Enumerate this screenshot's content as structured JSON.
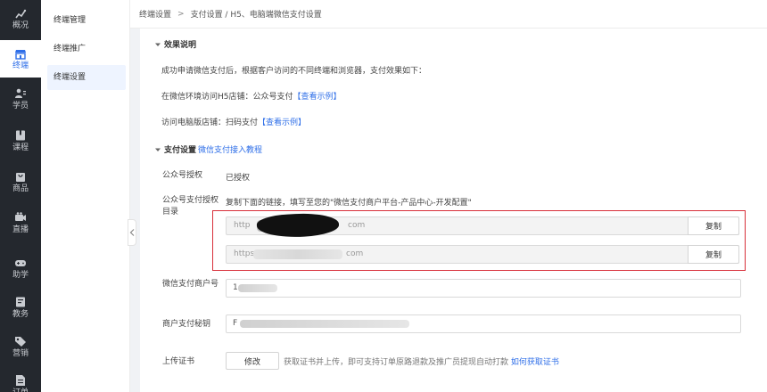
{
  "rail": {
    "items": [
      {
        "label": "概况",
        "icon": "chart-icon"
      },
      {
        "label": "终端",
        "icon": "store-icon"
      },
      {
        "label": "学员",
        "icon": "users-icon"
      },
      {
        "label": "课程",
        "icon": "book-icon"
      },
      {
        "label": "商品",
        "icon": "bag-icon"
      },
      {
        "label": "直播",
        "icon": "video-icon"
      },
      {
        "label": "助学",
        "icon": "gamepad-icon"
      },
      {
        "label": "教务",
        "icon": "notebook-icon"
      },
      {
        "label": "营销",
        "icon": "tag-icon"
      },
      {
        "label": "订单",
        "icon": "document-icon"
      }
    ],
    "active_index": 1,
    "active_color": "#2f6fe8",
    "background": "#24282e"
  },
  "subnav": {
    "items": [
      {
        "label": "终端管理"
      },
      {
        "label": "终端推广"
      },
      {
        "label": "终端设置"
      }
    ],
    "active_index": 2
  },
  "breadcrumb": {
    "root": "终端设置",
    "separator": ">",
    "current": "支付设置 / H5、电脑端微信支付设置"
  },
  "effect": {
    "title": "效果说明",
    "intro": "成功申请微信支付后，根据客户访问的不同终端和浏览器，支付效果如下：",
    "line1_text": "在微信环境访问H5店铺：公众号支付",
    "line1_link": "【查看示例】",
    "line2_text": "访问电脑版店铺：扫码支付",
    "line2_link": "【查看示例】"
  },
  "pay": {
    "title": "支付设置",
    "tutorial_link": "微信支付接入教程",
    "auth_label": "公众号授权",
    "auth_value": "已授权",
    "dir_label": "公众号支付授权目录",
    "dir_hint": "复制下面的链接，填写至您的\"微信支付商户平台-产品中心-开发配置\"",
    "url1_prefix": "http",
    "url1_suffix": "com",
    "url2_prefix": "https:",
    "url2_suffix": "com",
    "copy_label": "复制",
    "merchant_label": "微信支付商户号",
    "merchant_prefix": "1",
    "secret_label": "商户支付秘钥",
    "secret_prefix": "F",
    "cert_label": "上传证书",
    "cert_button": "修改",
    "cert_tip": "获取证书并上传，即可支持订单原路退款及推广员提现自动打款",
    "cert_link": "如何获取证书",
    "highlight_color": "#d8303a",
    "link_color": "#2f6fe8"
  }
}
